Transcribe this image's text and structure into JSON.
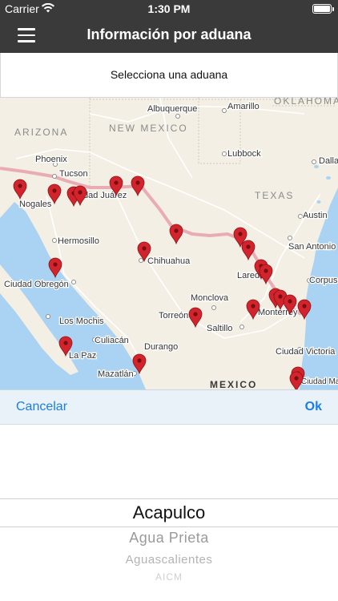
{
  "status_bar": {
    "carrier": "Carrier",
    "time": "1:30 PM",
    "wifi_icon": "wifi-icon",
    "battery_icon": "battery-icon"
  },
  "nav": {
    "title": "Información por aduana",
    "menu_icon": "hamburger-menu-icon"
  },
  "select": {
    "label": "Selecciona una aduana"
  },
  "map": {
    "labels": {
      "oklahoma": "OKLAHOMA",
      "arizona": "ARIZONA",
      "new_mexico": "NEW MEXICO",
      "texas": "TEXAS",
      "mexico": "MEXICO",
      "albuquerque": "Albuquerque",
      "amarillo": "Amarillo",
      "lubbock": "Lubbock",
      "dallas": "Dalla",
      "phoenix": "Phoenix",
      "tucson": "Tucson",
      "nogales": "Nogales",
      "ciudad_juarez": "dad Juárez",
      "hermosillo": "Hermosillo",
      "chihuahua": "Chihuahua",
      "ciudad_obregon": "Ciudad Obregón",
      "los_mochis": "Los Mochis",
      "culiacan": "Culiacán",
      "la_paz": "La Paz",
      "mazatlan": "Mazatlán",
      "durango": "Durango",
      "torreon": "Torreón",
      "saltillo": "Saltillo",
      "monclova": "Monclova",
      "monterrey": "Monterrey",
      "laredo": "Laredo",
      "san_antonio": "San Antonio",
      "austin": "Austin",
      "corpus": "Corpus",
      "ciudad_victoria": "Ciudad Victoria",
      "ciudad_madero": "Ciudad Ma"
    },
    "marker_icon": "map-pin-icon",
    "colors": {
      "land": "#f3efe4",
      "water": "#a9d2f3",
      "border": "#e8a3ae",
      "pin": "#d2242c"
    }
  },
  "toolbar": {
    "cancel": "Cancelar",
    "ok": "Ok"
  },
  "picker": {
    "options": [
      "Acapulco",
      "Agua Prieta",
      "Aguascalientes",
      "AICM"
    ],
    "selected": "Acapulco"
  }
}
